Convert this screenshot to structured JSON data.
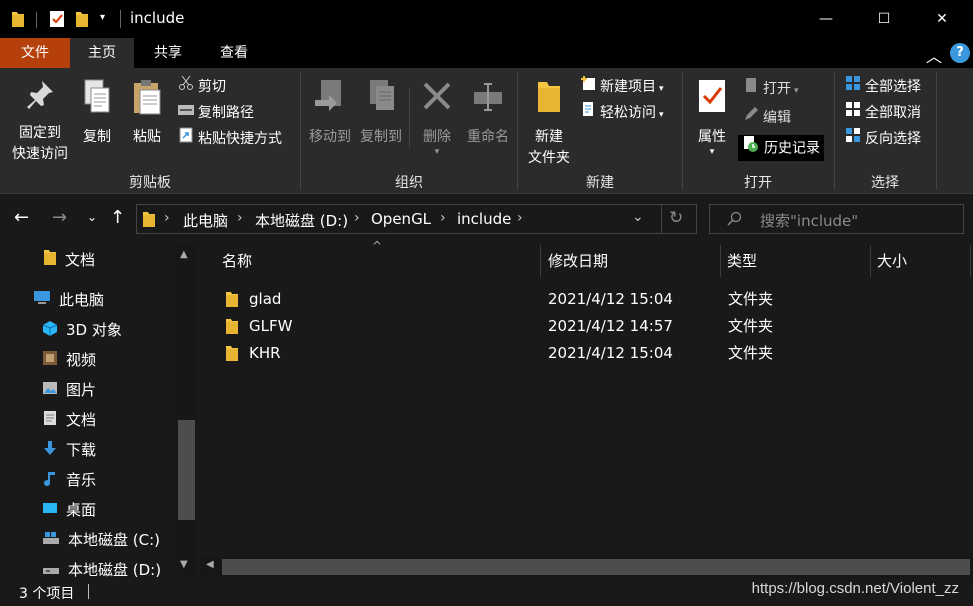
{
  "window": {
    "title": "include",
    "controls": {
      "minimize": "—",
      "maximize": "☐",
      "close": "✕"
    }
  },
  "ribbon_tabs": [
    {
      "label": "文件"
    },
    {
      "label": "主页"
    },
    {
      "label": "共享"
    },
    {
      "label": "查看"
    }
  ],
  "ribbon": {
    "clipboard": {
      "pin_line1": "固定到",
      "pin_line2": "快速访问",
      "copy": "复制",
      "paste": "粘贴",
      "cut": "剪切",
      "copy_path": "复制路径",
      "paste_shortcut": "粘贴快捷方式",
      "group_label": "剪贴板"
    },
    "organize": {
      "move_to": "移动到",
      "copy_to": "复制到",
      "delete": "删除",
      "rename": "重命名",
      "group_label": "组织"
    },
    "new": {
      "new_folder_line1": "新建",
      "new_folder_line2": "文件夹",
      "new_item": "新建项目",
      "easy_access": "轻松访问",
      "group_label": "新建"
    },
    "open": {
      "properties": "属性",
      "open": "打开",
      "edit": "编辑",
      "history": "历史记录",
      "group_label": "打开"
    },
    "select": {
      "select_all": "全部选择",
      "select_none": "全部取消",
      "invert": "反向选择",
      "group_label": "选择"
    }
  },
  "address": {
    "crumbs": [
      "此电脑",
      "本地磁盘 (D:)",
      "OpenGL",
      "include"
    ],
    "search_placeholder": "搜索\"include\""
  },
  "nav_pane": {
    "items": [
      {
        "label": "文档",
        "icon": "document-icon"
      },
      {
        "label": "此电脑",
        "icon": "computer-icon"
      },
      {
        "label": "3D 对象",
        "icon": "cube-icon"
      },
      {
        "label": "视频",
        "icon": "video-icon"
      },
      {
        "label": "图片",
        "icon": "picture-icon"
      },
      {
        "label": "文档",
        "icon": "document-icon"
      },
      {
        "label": "下载",
        "icon": "download-icon"
      },
      {
        "label": "音乐",
        "icon": "music-icon"
      },
      {
        "label": "桌面",
        "icon": "desktop-icon"
      },
      {
        "label": "本地磁盘 (C:)",
        "icon": "drive-icon"
      },
      {
        "label": "本地磁盘 (D:)",
        "icon": "drive-icon"
      }
    ]
  },
  "file_list": {
    "columns": {
      "name": "名称",
      "modified": "修改日期",
      "type": "类型",
      "size": "大小"
    },
    "rows": [
      {
        "name": "glad",
        "modified": "2021/4/12 15:04",
        "type": "文件夹"
      },
      {
        "name": "GLFW",
        "modified": "2021/4/12 14:57",
        "type": "文件夹"
      },
      {
        "name": "KHR",
        "modified": "2021/4/12 15:04",
        "type": "文件夹"
      }
    ]
  },
  "status": {
    "count": "3 个项目",
    "watermark": "https://blog.csdn.net/Violent_zz"
  },
  "colors": {
    "file_tab": "#b5400c",
    "ribbon_bg": "#2b2b2b",
    "window_bg": "#191919",
    "folder_yellow": "#f5c542",
    "accent_blue": "#3a96dd"
  }
}
